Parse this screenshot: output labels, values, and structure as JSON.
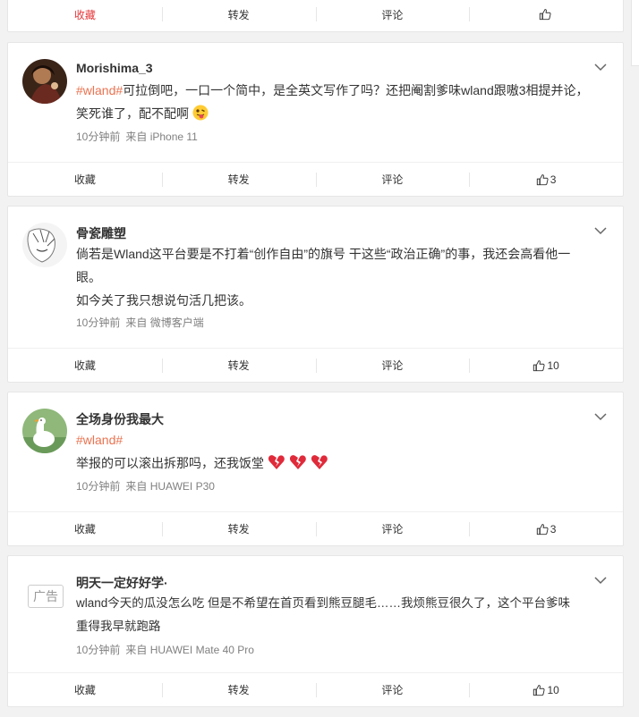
{
  "labels": {
    "favorite": "收藏",
    "repost": "转发",
    "comment": "评论"
  },
  "top_bar": {
    "favorite": "收藏",
    "repost": "转发",
    "comment": "评论",
    "like_count": ""
  },
  "posts": [
    {
      "user": "Morishima_3",
      "hashtag": "#wland#",
      "line1": "可拉倒吧，一口一个简中，是全英文写作了吗？还把阉割爹味wland跟嗷3相提并论，",
      "line2": "笑死谁了，配不配啊",
      "time": "10分钟前",
      "source": "来自 iPhone 11",
      "like_count": "3"
    },
    {
      "user": "骨瓷雕塑",
      "line1": "倘若是Wland这平台要是不打着“创作自由”的旗号 干这些“政治正确”的事，我还会高看他一",
      "line2": "眼。",
      "line3": "如今关了我只想说句活几把该。",
      "time": "10分钟前",
      "source": "来自 微博客户端",
      "like_count": "10"
    },
    {
      "user": "全场身份我最大",
      "hashtag": "#wland#",
      "line2": "举报的可以滚出拆那吗，还我饭堂",
      "time": "10分钟前",
      "source": "来自 HUAWEI P30",
      "like_count": "3"
    },
    {
      "user": "明天一定好好学·",
      "ad_label": "广告",
      "line1": "wland今天的瓜没怎么吃 但是不希望在首页看到熊豆腿毛……我烦熊豆很久了，这个平台爹味",
      "line2": "重得我早就跑路",
      "time": "10分钟前",
      "source": "来自 HUAWEI Mate 40 Pro",
      "like_count": "10"
    }
  ],
  "colors": {
    "favorite_red": "#e4393c",
    "hashtag_orange": "#eb7350",
    "meta_gray": "#808080"
  },
  "icons": [
    "like-icon",
    "chevron-down-icon",
    "tongue-emoji-icon",
    "broken-heart-icon"
  ]
}
